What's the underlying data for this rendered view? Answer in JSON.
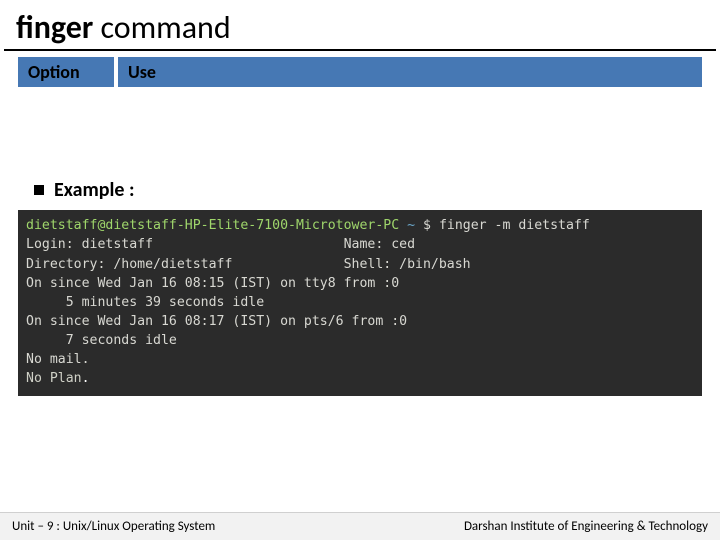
{
  "title": {
    "bold": "finger",
    "rest": " command"
  },
  "table": {
    "headers": [
      "Option",
      "Use"
    ]
  },
  "example_label": "Example :",
  "terminal": {
    "prompt_user": "dietstaff@dietstaff-HP-Elite-7100-Microtower-PC",
    "prompt_tilde": "~",
    "prompt_dollar": "$",
    "command": "finger -m dietstaff",
    "lines": [
      "Login: dietstaff                        Name: ced",
      "Directory: /home/dietstaff              Shell: /bin/bash",
      "On since Wed Jan 16 08:15 (IST) on tty8 from :0",
      "     5 minutes 39 seconds idle",
      "On since Wed Jan 16 08:17 (IST) on pts/6 from :0",
      "     7 seconds idle",
      "No mail."
    ],
    "last_line_prefix": "No Plan",
    "last_line_suffix": "."
  },
  "footer": {
    "left_prefix": "Unit ",
    "left_dash": "– ",
    "left_rest": "9  : Unix/Linux Operating System",
    "right": "Darshan Institute of Engineering & Technology"
  }
}
